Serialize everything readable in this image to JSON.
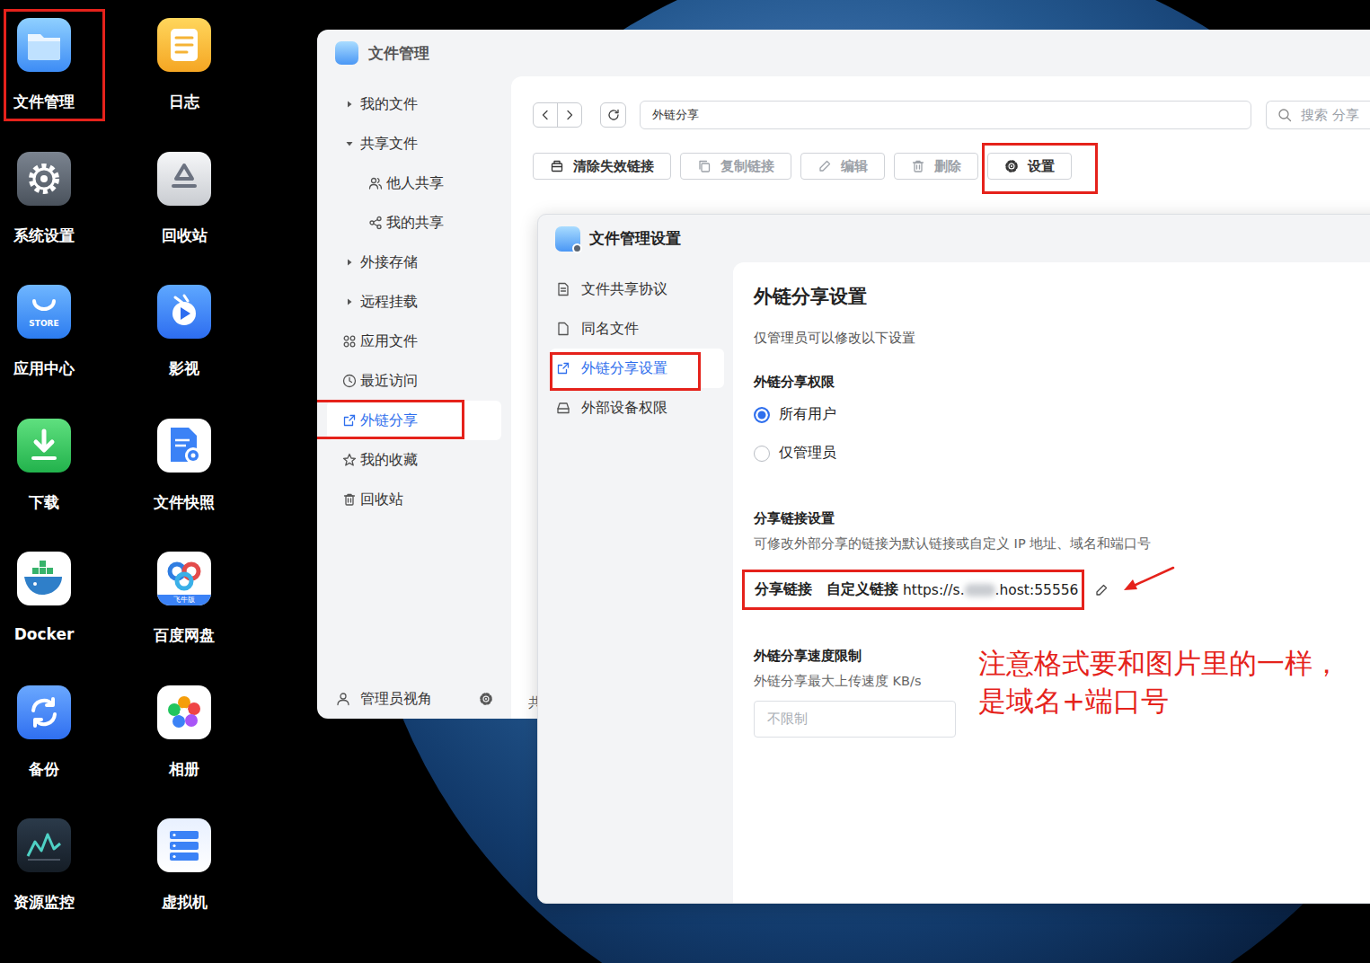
{
  "desktop": {
    "icons": [
      {
        "label": "文件管理",
        "kind": "files",
        "highlighted": true
      },
      {
        "label": "日志",
        "kind": "log",
        "highlighted": false
      },
      {
        "label": "系统设置",
        "kind": "settings",
        "highlighted": false
      },
      {
        "label": "回收站",
        "kind": "recycle",
        "highlighted": false
      },
      {
        "label": "应用中心",
        "kind": "store",
        "badge": "STORE",
        "highlighted": false
      },
      {
        "label": "影视",
        "kind": "video",
        "highlighted": false
      },
      {
        "label": "下载",
        "kind": "download",
        "highlighted": false
      },
      {
        "label": "文件快照",
        "kind": "snapshot",
        "highlighted": false
      },
      {
        "label": "Docker",
        "kind": "docker",
        "highlighted": false
      },
      {
        "label": "百度网盘",
        "kind": "baidu",
        "badge": "飞牛版",
        "highlighted": false
      },
      {
        "label": "备份",
        "kind": "backup",
        "highlighted": false
      },
      {
        "label": "相册",
        "kind": "photos",
        "highlighted": false
      },
      {
        "label": "资源监控",
        "kind": "monitor",
        "highlighted": false
      },
      {
        "label": "虚拟机",
        "kind": "vm",
        "highlighted": false
      }
    ]
  },
  "window": {
    "title": "文件管理"
  },
  "sidebar": {
    "items": [
      {
        "label": "我的文件",
        "kind": "group",
        "expanded": false,
        "selected": false,
        "highlighted": false
      },
      {
        "label": "共享文件",
        "kind": "group",
        "expanded": true,
        "selected": false,
        "highlighted": false
      },
      {
        "label": "他人共享",
        "kind": "people",
        "selected": false,
        "highlighted": false
      },
      {
        "label": "我的共享",
        "kind": "share",
        "selected": false,
        "highlighted": false
      },
      {
        "label": "外接存储",
        "kind": "group",
        "expanded": false,
        "selected": false,
        "highlighted": false
      },
      {
        "label": "远程挂载",
        "kind": "group",
        "expanded": false,
        "selected": false,
        "highlighted": false
      },
      {
        "label": "应用文件",
        "kind": "apps",
        "selected": false,
        "highlighted": false
      },
      {
        "label": "最近访问",
        "kind": "recent",
        "selected": false,
        "highlighted": false
      },
      {
        "label": "外链分享",
        "kind": "link",
        "selected": true,
        "highlighted": true
      },
      {
        "label": "我的收藏",
        "kind": "star",
        "selected": false,
        "highlighted": false
      },
      {
        "label": "回收站",
        "kind": "trash",
        "selected": false,
        "highlighted": false
      }
    ],
    "footer": {
      "label": "管理员视角"
    }
  },
  "toolbar": {
    "path": "外链分享",
    "search_placeholder": "搜索 分享"
  },
  "actions": [
    {
      "label": "清除失效链接",
      "kind": "clean",
      "disabled": false,
      "highlighted": false
    },
    {
      "label": "复制链接",
      "kind": "copy",
      "disabled": true,
      "highlighted": false
    },
    {
      "label": "编辑",
      "kind": "edit",
      "disabled": true,
      "highlighted": false
    },
    {
      "label": "删除",
      "kind": "delete",
      "disabled": true,
      "highlighted": false
    },
    {
      "label": "设置",
      "kind": "gear",
      "disabled": false,
      "highlighted": true
    }
  ],
  "status_bar": {
    "text": "共"
  },
  "dialog": {
    "title": "文件管理设置",
    "nav": [
      {
        "label": "文件共享协议",
        "kind": "doc",
        "selected": false,
        "highlighted": false
      },
      {
        "label": "同名文件",
        "kind": "file",
        "selected": false,
        "highlighted": false
      },
      {
        "label": "外链分享设置",
        "kind": "link",
        "selected": true,
        "highlighted": true
      },
      {
        "label": "外部设备权限",
        "kind": "drive",
        "selected": false,
        "highlighted": false
      }
    ],
    "content": {
      "heading": "外链分享设置",
      "note": "仅管理员可以修改以下设置",
      "permission": {
        "title": "外链分享权限",
        "options": [
          {
            "label": "所有用户",
            "selected": true
          },
          {
            "label": "仅管理员",
            "selected": false
          }
        ]
      },
      "link_settings": {
        "title": "分享链接设置",
        "description": "可修改外部分享的链接为默认链接或自定义 IP 地址、域名和端口号",
        "label": "分享链接",
        "mode": "自定义链接",
        "url_start": "https://s.",
        "url_end": ".host:55556",
        "url_redacted": true,
        "highlighted": true
      },
      "speed": {
        "title": "外链分享速度限制",
        "description": "外链分享最大上传速度 KB/s",
        "placeholder": "不限制"
      }
    }
  },
  "annotation": {
    "lines": [
      "注意格式要和图片里的一样，",
      "是域名+端口号"
    ],
    "arrow": true
  }
}
